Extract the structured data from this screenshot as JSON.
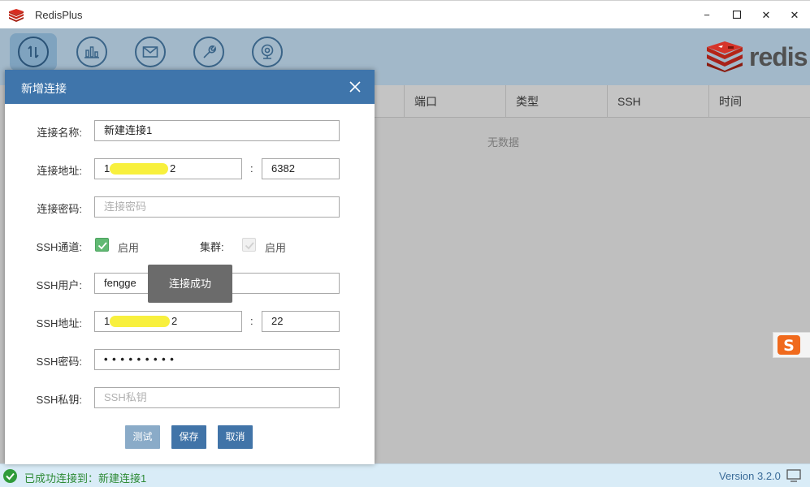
{
  "window": {
    "title": "RedisPlus",
    "minimize": "−",
    "maximize": "☐",
    "close": "✕"
  },
  "toolbar": {
    "items": [
      {
        "icon": "transfer-icon",
        "active": true
      },
      {
        "icon": "chart-icon",
        "active": false
      },
      {
        "icon": "mail-icon",
        "active": false
      },
      {
        "icon": "wrench-icon",
        "active": false
      },
      {
        "icon": "webcam-icon",
        "active": false
      }
    ],
    "logo_text": "redis"
  },
  "table": {
    "columns": [
      "端口",
      "类型",
      "SSH",
      "时间"
    ],
    "empty_text": "无数据"
  },
  "dialog": {
    "title": "新增连接",
    "fields": {
      "name_label": "连接名称:",
      "name_value": "新建连接1",
      "host_label": "连接地址:",
      "host_value_prefix": "1",
      "host_value_suffix": "2",
      "host_colon": ":",
      "port_value": "6382",
      "password_label": "连接密码:",
      "password_placeholder": "连接密码",
      "ssh_label": "SSH通道:",
      "ssh_enable_label": "启用",
      "ssh_enabled": true,
      "cluster_label": "集群:",
      "cluster_enable_label": "启用",
      "cluster_enabled": false,
      "ssh_user_label": "SSH用户:",
      "ssh_user_value": "fengge",
      "ssh_host_label": "SSH地址:",
      "ssh_host_value_prefix": "1",
      "ssh_host_value_suffix": "2",
      "ssh_host_colon": ":",
      "ssh_port_value": "22",
      "ssh_password_label": "SSH密码:",
      "ssh_password_value": "• • • • • • • • •",
      "ssh_key_label": "SSH私钥:",
      "ssh_key_placeholder": "SSH私钥"
    },
    "toast": "连接成功",
    "buttons": {
      "test": "测试",
      "save": "保存",
      "cancel": "取消"
    }
  },
  "status": {
    "message": "已成功连接到：新建连接1",
    "version": "Version 3.2.0"
  },
  "colors": {
    "dialog_header": "#3f75ab",
    "primary_button": "#4174a8",
    "status_green": "#2d8a35",
    "checkbox_green": "#61b973"
  }
}
